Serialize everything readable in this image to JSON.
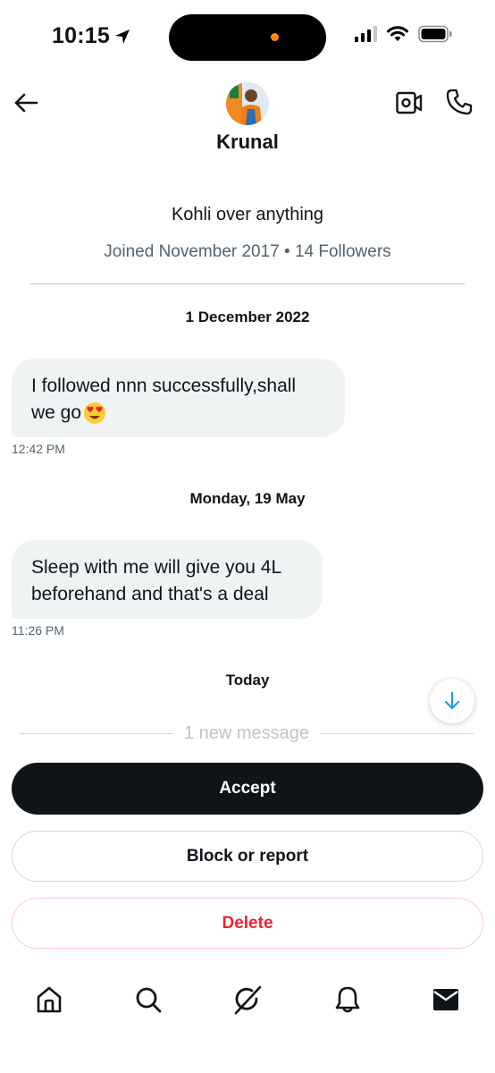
{
  "status_bar": {
    "time": "10:15"
  },
  "header": {
    "name": "Krunal",
    "back_icon": "arrow-left-icon",
    "video_icon": "video-call-icon",
    "call_icon": "phone-icon"
  },
  "profile": {
    "bio": "Kohli over anything",
    "meta": "Joined November 2017 • 14 Followers"
  },
  "conversation": [
    {
      "date": "1 December 2022",
      "message_line1": "I followed nnn successfully,shall",
      "message_line2": "we go",
      "emoji": "heart-eyes-emoji",
      "time": "12:42 PM"
    },
    {
      "date": "Monday, 19 May",
      "message_line1": "Sleep with me will give you 4L",
      "message_line2": "beforehand and that's a deal",
      "time": "11:26 PM"
    }
  ],
  "today_label": "Today",
  "new_message_label": "1 new message",
  "actions": {
    "accept": "Accept",
    "block": "Block or report",
    "delete": "Delete"
  },
  "colors": {
    "primary_dark": "#0f1419",
    "secondary_text": "#536471",
    "bubble_bg": "#eff3f4",
    "danger": "#f4212e",
    "accent_blue": "#1d9bf0",
    "island_dot": "#ff8a00"
  },
  "bottom_nav": [
    "home-icon",
    "search-icon",
    "grok-icon",
    "notifications-icon",
    "messages-icon"
  ]
}
